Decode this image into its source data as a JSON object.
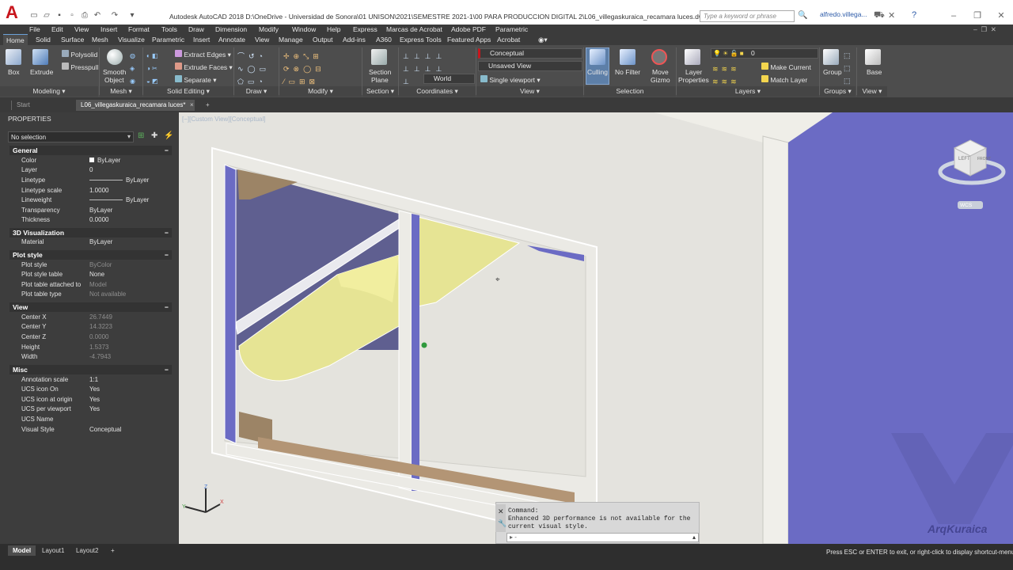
{
  "app": {
    "logo": "A",
    "title": "Autodesk AutoCAD 2018    D:\\OneDrive - Universidad de Sonora\\01 UNISON\\2021\\SEMESTRE 2021-1\\00 PARA PRODUCCION DIGITAL 2\\L06_villegaskuraica_recamara luces.dwg",
    "search_placeholder": "Type a keyword or phrase",
    "user": "alfredo.villega..."
  },
  "menu": [
    "File",
    "Edit",
    "View",
    "Insert",
    "Format",
    "Tools",
    "Draw",
    "Dimension",
    "Modify",
    "Window",
    "Help",
    "Express",
    "Marcas de Acrobat",
    "Adobe PDF",
    "Parametric"
  ],
  "ribbon_tabs": [
    "Home",
    "Solid",
    "Surface",
    "Mesh",
    "Visualize",
    "Parametric",
    "Insert",
    "Annotate",
    "View",
    "Manage",
    "Output",
    "Add-ins",
    "A360",
    "Express Tools",
    "Featured Apps",
    "Acrobat"
  ],
  "ribbon": {
    "box": "Box",
    "extrude": "Extrude",
    "polysolid": "Polysolid",
    "presspull": "Presspull",
    "smooth1": "Smooth",
    "smooth2": "Object",
    "extract_edges": "Extract Edges",
    "extrude_faces": "Extrude Faces",
    "separate": "Separate",
    "section1": "Section",
    "section2": "Plane",
    "visual_style": "Conceptual",
    "view_name": "Unsaved View",
    "ucs": "World",
    "viewport": "Single viewport",
    "culling": "Culling",
    "nofilter": "No Filter",
    "gizmo1": "Move",
    "gizmo2": "Gizmo",
    "layerprops1": "Layer",
    "layerprops2": "Properties",
    "layer_current": "0",
    "make_current": "Make Current",
    "match_layer": "Match Layer",
    "group": "Group",
    "base": "Base",
    "panels": [
      "Modeling",
      "Mesh",
      "Solid Editing",
      "Draw",
      "Modify",
      "Section",
      "Coordinates",
      "View",
      "Selection",
      "Layers",
      "Groups",
      "View"
    ]
  },
  "doc_tabs": [
    "Start",
    "L06_villegaskuraica_recamara luces*"
  ],
  "properties": {
    "title": "PROPERTIES",
    "selection": "No selection",
    "sections": [
      {
        "name": "General",
        "rows": [
          [
            "Color",
            "ByLayer"
          ],
          [
            "Layer",
            "0"
          ],
          [
            "Linetype",
            "ByLayer"
          ],
          [
            "Linetype scale",
            "1.0000"
          ],
          [
            "Lineweight",
            "ByLayer"
          ],
          [
            "Transparency",
            "ByLayer"
          ],
          [
            "Thickness",
            "0.0000"
          ]
        ]
      },
      {
        "name": "3D Visualization",
        "rows": [
          [
            "Material",
            "ByLayer"
          ]
        ]
      },
      {
        "name": "Plot style",
        "rows": [
          [
            "Plot style",
            "ByColor"
          ],
          [
            "Plot style table",
            "None"
          ],
          [
            "Plot table attached to",
            "Model"
          ],
          [
            "Plot table type",
            "Not available"
          ]
        ]
      },
      {
        "name": "View",
        "rows": [
          [
            "Center X",
            "26.7449"
          ],
          [
            "Center Y",
            "14.3223"
          ],
          [
            "Center Z",
            "0.0000"
          ],
          [
            "Height",
            "1.5373"
          ],
          [
            "Width",
            "-4.7943"
          ]
        ]
      },
      {
        "name": "Misc",
        "rows": [
          [
            "Annotation scale",
            "1:1"
          ],
          [
            "UCS icon On",
            "Yes"
          ],
          [
            "UCS icon at origin",
            "Yes"
          ],
          [
            "UCS per viewport",
            "Yes"
          ],
          [
            "UCS Name",
            ""
          ],
          [
            "Visual Style",
            "Conceptual"
          ]
        ]
      }
    ]
  },
  "viewport": {
    "label": "[−][Custom View][Conceptual]",
    "viewcube_face1": "LEFT",
    "viewcube_face2": "FRONT",
    "wcs": "WCS"
  },
  "command": {
    "line1": "Command:",
    "line2": "Enhanced 3D performance is not available for the",
    "line3": "current visual style.",
    "prompt": "▸ -"
  },
  "layout_tabs": [
    "Model",
    "Layout1",
    "Layout2"
  ],
  "status_text": "Press ESC or ENTER to exit, or right-click to display shortcut-menu",
  "watermark": "ArqKuraica",
  "colors": {
    "wall_blue": "#6b6bc4",
    "accent_red": "#c8161d"
  }
}
